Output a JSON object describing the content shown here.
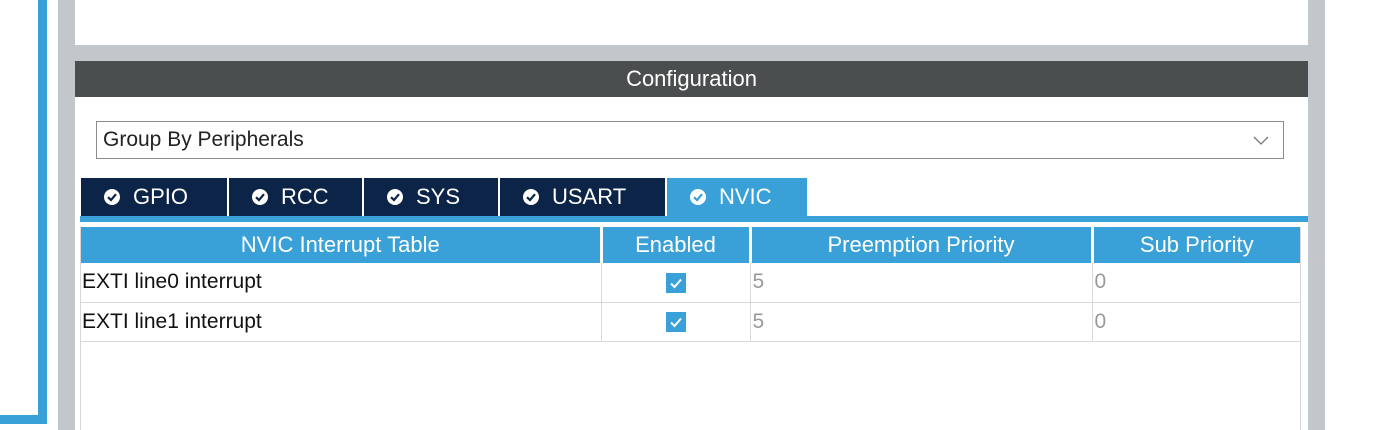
{
  "configuration": {
    "title": "Configuration",
    "group_select": {
      "value": "Group By Peripherals",
      "icon": "chevron-down-icon"
    },
    "tabs": [
      {
        "label": "GPIO",
        "icon": "check-circle-icon",
        "active": false
      },
      {
        "label": "RCC",
        "icon": "check-circle-icon",
        "active": false
      },
      {
        "label": "SYS",
        "icon": "check-circle-icon",
        "active": false
      },
      {
        "label": "USART",
        "icon": "check-circle-icon",
        "active": false
      },
      {
        "label": "NVIC",
        "icon": "check-circle-icon",
        "active": true
      }
    ],
    "nvic_table": {
      "columns": [
        "NVIC Interrupt Table",
        "Enabled",
        "Preemption Priority",
        "Sub Priority"
      ],
      "rows": [
        {
          "name": "EXTI line0 interrupt",
          "enabled": true,
          "preemption": "5",
          "sub": "0"
        },
        {
          "name": "EXTI line1 interrupt",
          "enabled": true,
          "preemption": "5",
          "sub": "0"
        }
      ]
    }
  },
  "colors": {
    "accent": "#39a0d8",
    "tab_dark": "#0b2447",
    "header_dark": "#4b4e4f",
    "frame_grey": "#c2c7cb"
  }
}
